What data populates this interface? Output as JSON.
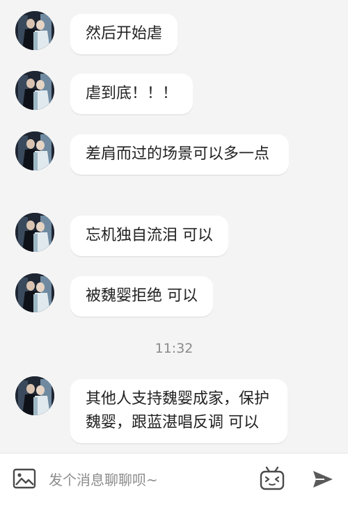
{
  "messages": [
    {
      "text": "然后开始虐"
    },
    {
      "text": "虐到底！！！"
    },
    {
      "text": "差肩而过的场景可以多一点"
    },
    {
      "text": "忘机独自流泪 可以"
    },
    {
      "text": "被魏婴拒绝 可以"
    },
    {
      "text": "其他人支持魏婴成家，保护魏婴，跟蓝湛唱反调  可以"
    }
  ],
  "timestamp": "11:32",
  "input": {
    "placeholder": "发个消息聊聊呗~"
  },
  "icons": {
    "image": "image-icon",
    "emoji": "bilibili-emoji-icon",
    "send": "send-icon"
  },
  "colors": {
    "background": "#f4f4f4",
    "bubble": "#ffffff",
    "text": "#222222",
    "muted": "#8a8a8a"
  }
}
